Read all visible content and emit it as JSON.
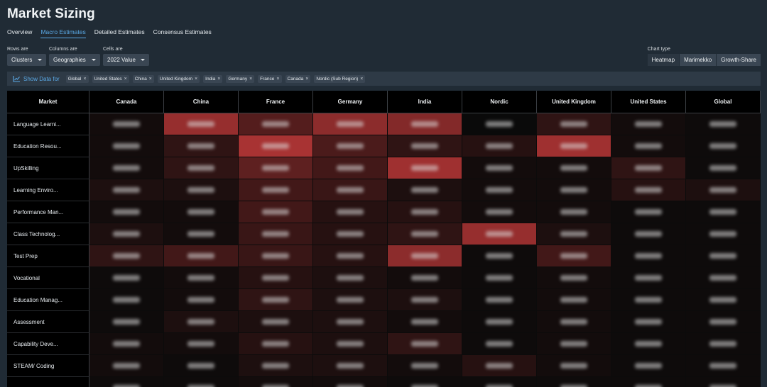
{
  "title": "Market Sizing",
  "tabs": [
    {
      "label": "Overview",
      "active": false
    },
    {
      "label": "Macro Estimates",
      "active": true
    },
    {
      "label": "Detailed Estimates",
      "active": false
    },
    {
      "label": "Consensus Estimates",
      "active": false
    }
  ],
  "controls": {
    "rows": {
      "label": "Rows are",
      "value": "Clusters"
    },
    "columns": {
      "label": "Columns are",
      "value": "Geographies"
    },
    "cells": {
      "label": "Cells are",
      "value": "2022 Value"
    }
  },
  "chart_type": {
    "label": "Chart type",
    "options": [
      "Heatmap",
      "Marimekko",
      "Growth-Share"
    ],
    "selected": "Heatmap"
  },
  "filter": {
    "show_label": "Show Data for",
    "chips": [
      "Global",
      "United States",
      "China",
      "United Kingdom",
      "India",
      "Germany",
      "France",
      "Canada",
      "Nordic (Sub Region)"
    ]
  },
  "table": {
    "corner": "Market",
    "columns": [
      "Canada",
      "China",
      "France",
      "Germany",
      "India",
      "Nordic",
      "United Kingdom",
      "United States",
      "Global"
    ],
    "rows": [
      {
        "label": "Language Learni...",
        "heat": [
          0.05,
          0.75,
          0.4,
          0.7,
          0.65,
          0.0,
          0.2,
          0.05,
          0.02
        ]
      },
      {
        "label": "Education Resou...",
        "heat": [
          0.05,
          0.2,
          0.85,
          0.35,
          0.2,
          0.15,
          0.8,
          0.05,
          0.02
        ]
      },
      {
        "label": "UpSkilling",
        "heat": [
          0.05,
          0.2,
          0.45,
          0.3,
          0.8,
          0.05,
          0.05,
          0.2,
          0.02
        ]
      },
      {
        "label": "Learning Enviro...",
        "heat": [
          0.1,
          0.1,
          0.3,
          0.25,
          0.1,
          0.05,
          0.05,
          0.15,
          0.1
        ]
      },
      {
        "label": "Performance Man...",
        "heat": [
          0.05,
          0.05,
          0.3,
          0.15,
          0.15,
          0.05,
          0.05,
          0.02,
          0.02
        ]
      },
      {
        "label": "Class Technolog...",
        "heat": [
          0.1,
          0.05,
          0.25,
          0.15,
          0.2,
          0.75,
          0.1,
          0.02,
          0.02
        ]
      },
      {
        "label": "Test Prep",
        "heat": [
          0.2,
          0.3,
          0.25,
          0.15,
          0.7,
          0.02,
          0.3,
          0.02,
          0.02
        ]
      },
      {
        "label": "Vocational",
        "heat": [
          0.02,
          0.05,
          0.15,
          0.1,
          0.05,
          0.02,
          0.05,
          0.02,
          0.02
        ]
      },
      {
        "label": "Education Manag...",
        "heat": [
          0.02,
          0.05,
          0.2,
          0.1,
          0.1,
          0.02,
          0.05,
          0.02,
          0.02
        ]
      },
      {
        "label": "Assessment",
        "heat": [
          0.02,
          0.1,
          0.1,
          0.1,
          0.05,
          0.02,
          0.05,
          0.02,
          0.02
        ]
      },
      {
        "label": "Capability Deve...",
        "heat": [
          0.05,
          0.05,
          0.15,
          0.1,
          0.2,
          0.02,
          0.05,
          0.02,
          0.02
        ]
      },
      {
        "label": "STEAM/ Coding",
        "heat": [
          0.05,
          0.02,
          0.1,
          0.1,
          0.05,
          0.15,
          0.05,
          0.02,
          0.02
        ]
      },
      {
        "label": "",
        "heat": [
          0.02,
          0.02,
          0.05,
          0.05,
          0.02,
          0.02,
          0.02,
          0.02,
          0.02
        ]
      }
    ]
  },
  "colors": {
    "heat_high": "#c43a3a",
    "heat_low": "#0a0a0a",
    "accent": "#5aa9e6"
  }
}
